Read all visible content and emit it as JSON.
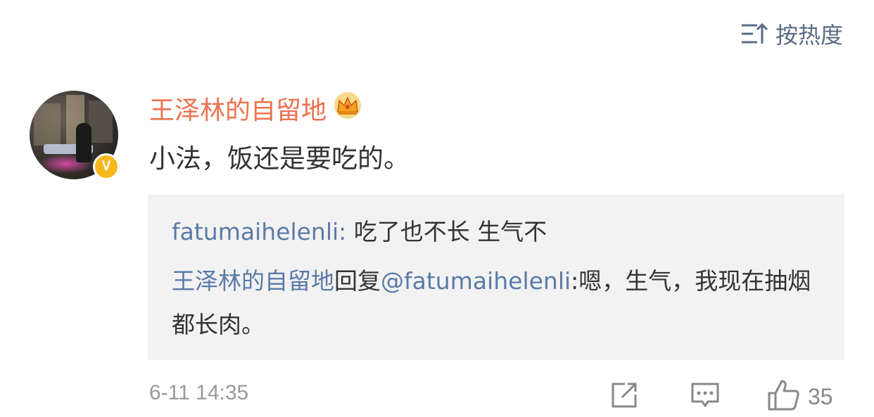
{
  "sort": {
    "label": "按热度",
    "icon": "sort-icon"
  },
  "comment": {
    "username": "王泽林的自留地",
    "crown_icon": "crown-icon",
    "verified_badge": "V",
    "text": "小法，饭还是要吃的。",
    "timestamp": "6-11 14:35",
    "like_count": "35"
  },
  "replies": [
    {
      "user": "fatumaihelenli",
      "sep": ": ",
      "text": "吃了也不长 生气不"
    },
    {
      "user": "王泽林的自留地",
      "action": "回复",
      "mention": "@fatumaihelenli",
      "text": ":嗯，生气，我现在抽烟都长肉。"
    }
  ],
  "colors": {
    "username": "#eb7350",
    "link": "#5b7ba8",
    "reply_bg": "#f2f2f2",
    "muted": "#999999"
  }
}
